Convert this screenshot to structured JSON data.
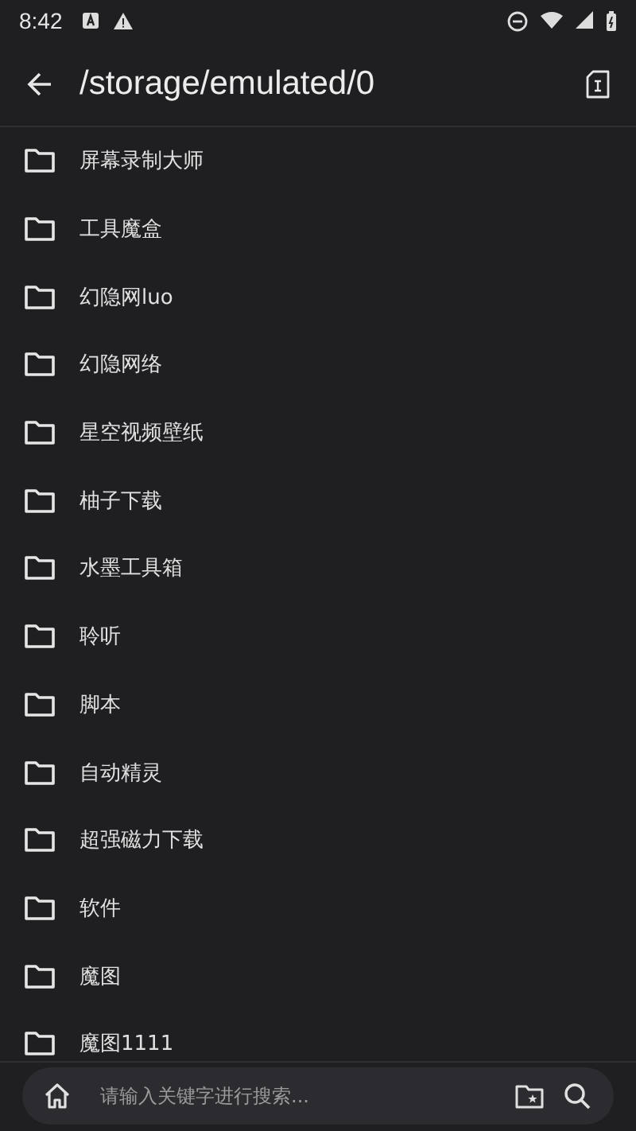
{
  "status_bar": {
    "time": "8:42"
  },
  "header": {
    "title": "/storage/emulated/0"
  },
  "folders": [
    {
      "name": "屏幕录制大师"
    },
    {
      "name": "工具魔盒"
    },
    {
      "name": "幻隐网luo"
    },
    {
      "name": "幻隐网络"
    },
    {
      "name": "星空视频壁纸"
    },
    {
      "name": "柚子下载"
    },
    {
      "name": "水墨工具箱"
    },
    {
      "name": "聆听"
    },
    {
      "name": "脚本"
    },
    {
      "name": "自动精灵"
    },
    {
      "name": "超强磁力下载"
    },
    {
      "name": "软件"
    },
    {
      "name": "魔图"
    },
    {
      "name": "魔图1111"
    }
  ],
  "search": {
    "placeholder": "请输入关键字进行搜索..."
  }
}
